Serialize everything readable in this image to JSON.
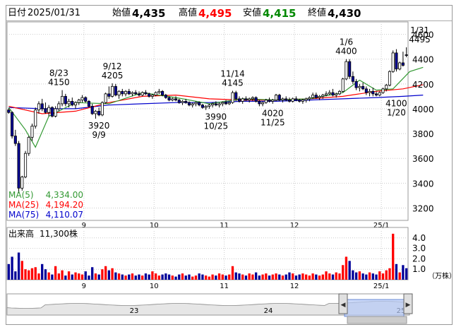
{
  "header": {
    "date_label": "日付",
    "date": "2025/01/31",
    "open_label": "始値",
    "open": "4,435",
    "high_label": "高値",
    "high": "4,495",
    "low_label": "安値",
    "low": "4,415",
    "close_label": "終値",
    "close": "4,430"
  },
  "colors": {
    "up": "#ff0000",
    "down": "#000099",
    "ma5": "#339933",
    "ma25": "#ff0000",
    "ma75": "#0000cc",
    "grid": "#999999",
    "nav_fill": "#b3c7f5"
  },
  "legend": [
    {
      "label": "MA(5)",
      "value": "4,334.00",
      "color": "#339933"
    },
    {
      "label": "MA(25)",
      "value": "4,194.20",
      "color": "#ff0000"
    },
    {
      "label": "MA(75)",
      "value": "4,110.07",
      "color": "#0000cc"
    }
  ],
  "volume_label": "出来高",
  "volume_value": "11,300株",
  "volume_unit": "（万株）",
  "month_labels": [
    "9",
    "10",
    "11",
    "12",
    "25/1"
  ],
  "nav_labels": [
    "23",
    "24",
    "25"
  ],
  "chart_data": [
    {
      "type": "candlestick",
      "ylim": [
        3100,
        4700
      ],
      "yticks": [
        3200,
        3400,
        3600,
        3800,
        4000,
        4200,
        4400,
        4600
      ],
      "annotations": [
        {
          "date": "8/23",
          "value": 4150
        },
        {
          "date": "9/9",
          "value": 3920
        },
        {
          "date": "9/12",
          "value": 4205
        },
        {
          "date": "10/25",
          "value": 3990
        },
        {
          "date": "11/14",
          "value": 4145
        },
        {
          "date": "11/25",
          "value": 4020
        },
        {
          "date": "1/6",
          "value": 4400
        },
        {
          "date": "1/20",
          "value": 4100
        },
        {
          "date": "1/31",
          "value": 4495
        }
      ],
      "candles": [
        [
          3990,
          4005,
          3960,
          3970
        ],
        [
          3970,
          3980,
          3760,
          3780
        ],
        [
          3780,
          3830,
          3700,
          3720
        ],
        [
          3720,
          3740,
          3320,
          3360
        ],
        [
          3360,
          3460,
          3340,
          3450
        ],
        [
          3450,
          3660,
          3440,
          3640
        ],
        [
          3640,
          3780,
          3620,
          3770
        ],
        [
          3770,
          3880,
          3740,
          3860
        ],
        [
          3860,
          4010,
          3840,
          3990
        ],
        [
          3990,
          4060,
          3960,
          4040
        ],
        [
          4040,
          4080,
          3980,
          4000
        ],
        [
          4000,
          4050,
          3960,
          3970
        ],
        [
          3970,
          4030,
          3940,
          4010
        ],
        [
          4010,
          4020,
          3930,
          3940
        ],
        [
          3940,
          4020,
          3930,
          4000
        ],
        [
          4000,
          4060,
          3980,
          4040
        ],
        [
          4040,
          4150,
          4020,
          4100
        ],
        [
          4100,
          4120,
          4020,
          4040
        ],
        [
          4040,
          4080,
          4010,
          4060
        ],
        [
          4060,
          4090,
          4020,
          4030
        ],
        [
          4030,
          4060,
          4000,
          4050
        ],
        [
          4050,
          4080,
          4030,
          4070
        ],
        [
          4070,
          4110,
          4050,
          4090
        ],
        [
          4090,
          4100,
          4050,
          4060
        ],
        [
          4060,
          4070,
          4010,
          4020
        ],
        [
          4020,
          4040,
          3950,
          3960
        ],
        [
          3960,
          3990,
          3920,
          3980
        ],
        [
          3980,
          4010,
          3940,
          3950
        ],
        [
          3950,
          4060,
          3940,
          4050
        ],
        [
          4050,
          4130,
          4040,
          4120
        ],
        [
          4120,
          4180,
          4080,
          4100
        ],
        [
          4100,
          4205,
          4090,
          4180
        ],
        [
          4180,
          4200,
          4100,
          4110
        ],
        [
          4110,
          4150,
          4080,
          4140
        ],
        [
          4140,
          4160,
          4100,
          4120
        ],
        [
          4120,
          4150,
          4100,
          4140
        ],
        [
          4140,
          4160,
          4110,
          4120
        ],
        [
          4120,
          4140,
          4100,
          4130
        ],
        [
          4130,
          4150,
          4110,
          4120
        ],
        [
          4120,
          4140,
          4100,
          4110
        ],
        [
          4110,
          4140,
          4100,
          4130
        ],
        [
          4130,
          4150,
          4110,
          4120
        ],
        [
          4120,
          4130,
          4090,
          4100
        ],
        [
          4100,
          4120,
          4080,
          4110
        ],
        [
          4110,
          4140,
          4100,
          4130
        ],
        [
          4130,
          4160,
          4120,
          4140
        ],
        [
          4140,
          4150,
          4100,
          4110
        ],
        [
          4110,
          4120,
          4080,
          4090
        ],
        [
          4090,
          4100,
          4060,
          4070
        ],
        [
          4070,
          4090,
          4060,
          4080
        ],
        [
          4080,
          4100,
          4060,
          4070
        ],
        [
          4070,
          4080,
          4040,
          4050
        ],
        [
          4050,
          4070,
          4030,
          4060
        ],
        [
          4060,
          4080,
          4040,
          4050
        ],
        [
          4050,
          4060,
          4020,
          4030
        ],
        [
          4030,
          4050,
          4010,
          4040
        ],
        [
          4040,
          4060,
          4020,
          4050
        ],
        [
          4050,
          4060,
          4020,
          4030
        ],
        [
          4030,
          4040,
          4000,
          4010
        ],
        [
          4010,
          4030,
          3990,
          4020
        ],
        [
          4020,
          4040,
          4000,
          4030
        ],
        [
          4030,
          4050,
          4010,
          4040
        ],
        [
          4040,
          4060,
          4020,
          4030
        ],
        [
          4030,
          4050,
          4010,
          4040
        ],
        [
          4040,
          4060,
          4020,
          4050
        ],
        [
          4050,
          4070,
          4030,
          4040
        ],
        [
          4040,
          4060,
          4030,
          4050
        ],
        [
          4050,
          4145,
          4040,
          4130
        ],
        [
          4130,
          4145,
          4060,
          4080
        ],
        [
          4080,
          4100,
          4050,
          4060
        ],
        [
          4060,
          4090,
          4040,
          4080
        ],
        [
          4080,
          4100,
          4060,
          4070
        ],
        [
          4070,
          4090,
          4050,
          4080
        ],
        [
          4080,
          4100,
          4060,
          4090
        ],
        [
          4090,
          4100,
          4050,
          4060
        ],
        [
          4060,
          4070,
          4020,
          4040
        ],
        [
          4040,
          4060,
          4020,
          4050
        ],
        [
          4050,
          4080,
          4040,
          4070
        ],
        [
          4070,
          4090,
          4050,
          4060
        ],
        [
          4060,
          4080,
          4040,
          4070
        ],
        [
          4070,
          4120,
          4060,
          4110
        ],
        [
          4110,
          4120,
          4060,
          4070
        ],
        [
          4070,
          4090,
          4050,
          4080
        ],
        [
          4080,
          4100,
          4060,
          4070
        ],
        [
          4070,
          4090,
          4050,
          4060
        ],
        [
          4060,
          4090,
          4050,
          4080
        ],
        [
          4080,
          4100,
          4060,
          4070
        ],
        [
          4070,
          4080,
          4050,
          4060
        ],
        [
          4060,
          4080,
          4040,
          4070
        ],
        [
          4070,
          4090,
          4050,
          4080
        ],
        [
          4080,
          4100,
          4060,
          4090
        ],
        [
          4090,
          4130,
          4080,
          4110
        ],
        [
          4110,
          4130,
          4080,
          4090
        ],
        [
          4090,
          4110,
          4070,
          4100
        ],
        [
          4100,
          4120,
          4080,
          4110
        ],
        [
          4110,
          4140,
          4100,
          4120
        ],
        [
          4120,
          4150,
          4110,
          4130
        ],
        [
          4130,
          4160,
          4100,
          4110
        ],
        [
          4110,
          4130,
          4090,
          4120
        ],
        [
          4120,
          4150,
          4110,
          4140
        ],
        [
          4140,
          4250,
          4130,
          4240
        ],
        [
          4240,
          4400,
          4230,
          4380
        ],
        [
          4380,
          4400,
          4240,
          4260
        ],
        [
          4260,
          4300,
          4200,
          4220
        ],
        [
          4220,
          4240,
          4150,
          4170
        ],
        [
          4170,
          4200,
          4140,
          4180
        ],
        [
          4180,
          4210,
          4150,
          4160
        ],
        [
          4160,
          4180,
          4110,
          4130
        ],
        [
          4130,
          4160,
          4100,
          4140
        ],
        [
          4140,
          4170,
          4100,
          4120
        ],
        [
          4120,
          4140,
          4100,
          4110
        ],
        [
          4110,
          4140,
          4100,
          4130
        ],
        [
          4130,
          4170,
          4120,
          4160
        ],
        [
          4160,
          4200,
          4140,
          4190
        ],
        [
          4190,
          4310,
          4180,
          4300
        ],
        [
          4300,
          4470,
          4290,
          4450
        ],
        [
          4450,
          4480,
          4300,
          4320
        ],
        [
          4320,
          4380,
          4310,
          4370
        ],
        [
          4370,
          4460,
          4340,
          4350
        ],
        [
          4435,
          4495,
          4415,
          4430
        ]
      ],
      "ma5": [
        [
          0,
          4010
        ],
        [
          5,
          3830
        ],
        [
          8,
          3690
        ],
        [
          12,
          3940
        ],
        [
          20,
          4050
        ],
        [
          30,
          4040
        ],
        [
          40,
          4130
        ],
        [
          50,
          4090
        ],
        [
          60,
          4040
        ],
        [
          70,
          4080
        ],
        [
          80,
          4070
        ],
        [
          90,
          4080
        ],
        [
          100,
          4130
        ],
        [
          105,
          4230
        ],
        [
          110,
          4150
        ],
        [
          115,
          4160
        ],
        [
          120,
          4300
        ],
        [
          124,
          4334
        ]
      ],
      "ma25": [
        [
          0,
          4020
        ],
        [
          10,
          3960
        ],
        [
          20,
          3980
        ],
        [
          30,
          4050
        ],
        [
          40,
          4100
        ],
        [
          50,
          4110
        ],
        [
          60,
          4080
        ],
        [
          70,
          4070
        ],
        [
          80,
          4070
        ],
        [
          90,
          4080
        ],
        [
          100,
          4100
        ],
        [
          110,
          4140
        ],
        [
          118,
          4160
        ],
        [
          124,
          4194
        ]
      ],
      "ma75": [
        [
          0,
          4010
        ],
        [
          10,
          4000
        ],
        [
          20,
          4000
        ],
        [
          30,
          4030
        ],
        [
          40,
          4040
        ],
        [
          50,
          4050
        ],
        [
          60,
          4050
        ],
        [
          70,
          4060
        ],
        [
          80,
          4060
        ],
        [
          90,
          4070
        ],
        [
          100,
          4080
        ],
        [
          110,
          4090
        ],
        [
          118,
          4100
        ],
        [
          124,
          4110
        ]
      ],
      "volume": [
        1.5,
        2.2,
        0.8,
        2.6,
        1.8,
        1.0,
        0.9,
        1.1,
        1.2,
        0.6,
        1.5,
        1.0,
        0.7,
        0.5,
        1.3,
        0.6,
        0.9,
        0.4,
        0.8,
        0.5,
        0.7,
        0.6,
        0.5,
        0.8,
        0.4,
        1.2,
        0.6,
        0.5,
        1.0,
        1.3,
        0.9,
        1.1,
        0.7,
        0.6,
        0.5,
        0.4,
        0.5,
        0.6,
        0.4,
        0.5,
        0.4,
        0.6,
        0.5,
        0.8,
        0.6,
        0.4,
        0.5,
        0.6,
        0.5,
        0.4,
        0.3,
        0.5,
        0.6,
        0.4,
        0.5,
        0.3,
        0.4,
        0.6,
        0.5,
        0.4,
        0.3,
        0.5,
        0.4,
        0.6,
        0.5,
        0.4,
        0.5,
        1.3,
        0.7,
        0.6,
        0.5,
        0.4,
        0.6,
        0.5,
        0.7,
        0.4,
        0.5,
        0.6,
        0.4,
        0.5,
        0.6,
        0.5,
        0.4,
        0.5,
        0.7,
        0.6,
        0.4,
        0.5,
        0.6,
        0.5,
        0.4,
        0.6,
        0.5,
        0.4,
        0.5,
        0.8,
        0.6,
        0.5,
        0.7,
        0.6,
        1.4,
        2.2,
        1.8,
        0.9,
        0.7,
        0.8,
        0.6,
        0.5,
        0.7,
        0.6,
        0.5,
        0.8,
        0.6,
        0.9,
        1.1,
        4.4,
        1.5,
        0.7,
        1.4,
        1.1
      ],
      "vol_ylim": [
        0,
        5
      ],
      "vol_yticks": [
        1.0,
        2.0,
        3.0,
        4.0
      ]
    }
  ]
}
